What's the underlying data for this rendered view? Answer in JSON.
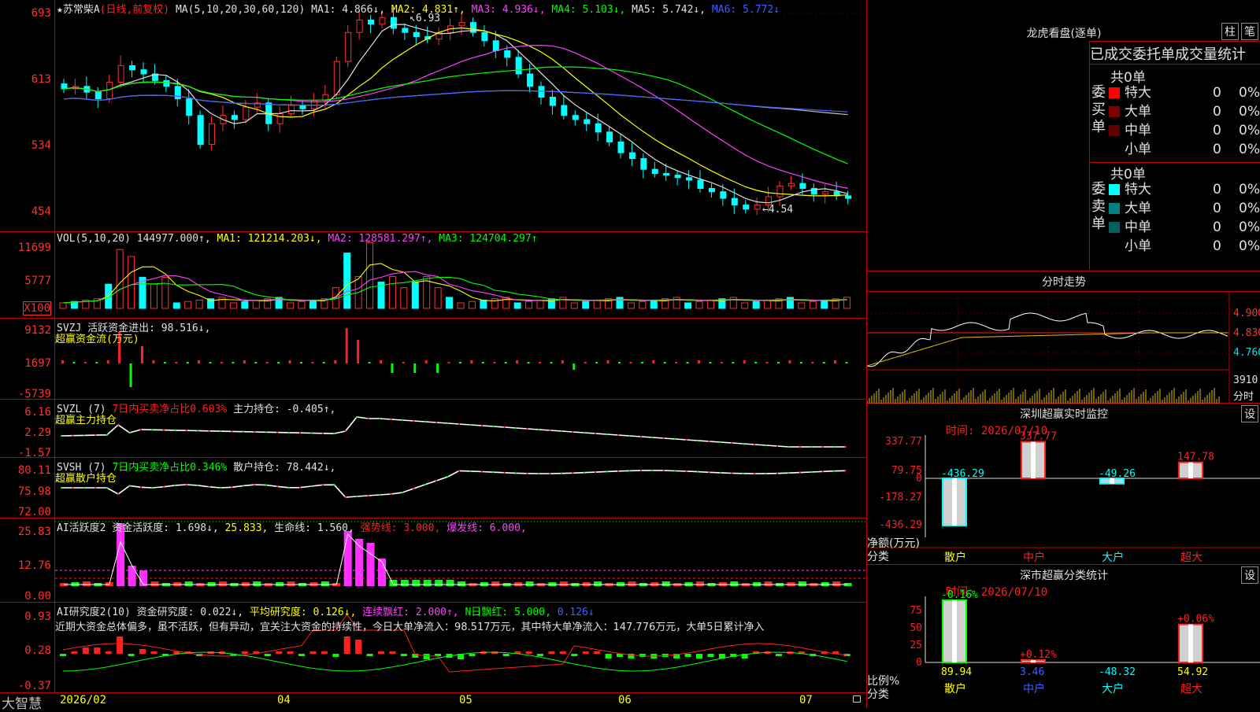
{
  "stock": {
    "name": "★苏常柴A",
    "mode": "(日线,前复权)"
  },
  "kline": {
    "ticks": [
      "693",
      "613",
      "534",
      "454"
    ],
    "ma_header": [
      {
        "t": "MA(5,10,20,30,60,120)",
        "c": "#e0e0e0"
      },
      {
        "t": " MA1: 4.866↓,",
        "c": "#e0e0e0"
      },
      {
        "t": " MA2: 4.831↑,",
        "c": "#ffff00"
      },
      {
        "t": " MA3: 4.936↓,",
        "c": "#ff40ff"
      },
      {
        "t": " MA4: 5.103↓,",
        "c": "#00ff00"
      },
      {
        "t": " MA5: 5.742↓,",
        "c": "#e0e0e0"
      },
      {
        "t": " MA6: 5.772↓",
        "c": "#4060ff"
      }
    ],
    "high_label": "6.93",
    "low_label": "4.54",
    "closes": [
      6.02,
      6.05,
      5.98,
      5.9,
      6.1,
      6.3,
      6.25,
      6.2,
      6.12,
      6.05,
      5.9,
      5.7,
      5.35,
      5.6,
      5.7,
      5.65,
      5.8,
      5.85,
      5.6,
      5.72,
      5.82,
      5.78,
      5.88,
      5.95,
      6.35,
      6.7,
      6.85,
      6.8,
      6.88,
      6.75,
      6.7,
      6.65,
      6.62,
      6.7,
      6.78,
      6.82,
      6.7,
      6.6,
      6.48,
      6.4,
      6.2,
      6.05,
      5.92,
      5.82,
      5.7,
      5.65,
      5.6,
      5.5,
      5.38,
      5.25,
      5.18,
      5.05,
      5.0,
      4.98,
      4.95,
      4.92,
      4.82,
      4.78,
      4.7,
      4.62,
      4.57,
      4.62,
      4.72,
      4.85,
      4.88,
      4.82,
      4.75,
      4.78,
      4.73,
      4.7
    ]
  },
  "vol": {
    "ticks": [
      "11699",
      "5777",
      "X100"
    ],
    "header": [
      {
        "t": "VOL(5,10,20)",
        "c": "#e0e0e0"
      },
      {
        "t": " 144977.000↑,",
        "c": "#e0e0e0"
      },
      {
        "t": " MA1: 121214.203↓,",
        "c": "#ffff00"
      },
      {
        "t": " MA2: 128581.297↑,",
        "c": "#ff40ff"
      },
      {
        "t": " MA3: 124704.297↑",
        "c": "#00ff00"
      }
    ]
  },
  "svzj": {
    "ticks": [
      "9132",
      "1697",
      "-5739"
    ],
    "header": [
      {
        "t": "SVZJ",
        "c": "#e0e0e0"
      },
      {
        "t": "  活跃资金进出: 98.516↓,",
        "c": "#e0e0e0"
      }
    ],
    "sub": "超赢资金流(万元)"
  },
  "svzl": {
    "ticks": [
      "6.16",
      "2.29",
      "-1.57"
    ],
    "header": [
      {
        "t": "SVZL (7)",
        "c": "#e0e0e0"
      },
      {
        "t": " 7日内买卖净占比0.603%",
        "c": "#ff2020"
      },
      {
        "t": " 主力持仓: -0.405↑,",
        "c": "#e0e0e0"
      }
    ],
    "sub": "超赢主力持仓"
  },
  "svsh": {
    "ticks": [
      "80.11",
      "75.98",
      "72.00"
    ],
    "header": [
      {
        "t": "SVSH (7)",
        "c": "#e0e0e0"
      },
      {
        "t": " 7日内买卖净占比0.346%",
        "c": "#00ff00"
      },
      {
        "t": " 散户持仓: 78.442↓,",
        "c": "#e0e0e0"
      }
    ],
    "sub": "超赢散户持仓"
  },
  "ai1": {
    "ticks": [
      "25.83",
      "12.76",
      "0.00"
    ],
    "header": [
      {
        "t": "AI活跃度2",
        "c": "#e0e0e0"
      },
      {
        "t": " 资金活跃度: 1.698↓,",
        "c": "#e0e0e0"
      },
      {
        "t": " 25.833,",
        "c": "#ffff00"
      },
      {
        "t": " 生命线: 1.560,",
        "c": "#e0e0e0"
      },
      {
        "t": " 强势线: 3.000,",
        "c": "#ff2020"
      },
      {
        "t": " 爆发线: 6.000,",
        "c": "#ff40ff"
      }
    ]
  },
  "ai2": {
    "ticks": [
      "0.93",
      "0.28",
      "-0.37"
    ],
    "header": [
      {
        "t": "AI研究度2(10)",
        "c": "#e0e0e0"
      },
      {
        "t": " 资金研究度: 0.022↓,",
        "c": "#e0e0e0"
      },
      {
        "t": " 平均研究度: 0.126↓,",
        "c": "#ffff00"
      },
      {
        "t": " 连续飘红: 2.000↑,",
        "c": "#ff40ff"
      },
      {
        "t": " N日飘红: 5.000,",
        "c": "#00ff00"
      },
      {
        "t": " 0.126↓",
        "c": "#4060ff"
      }
    ],
    "comment": "近期大资金总体偏多，虽不活跃，但有异动，宜关注大资金的持续性，今日大单净流入：98.517万元，其中特大单净流入：147.776万元，大单5日累计净入"
  },
  "dates": [
    "2026/02",
    "04",
    "05",
    "06",
    "07"
  ],
  "brand": "大智慧",
  "longhu": {
    "title": "龙虎看盘(逐单)",
    "btn_zhu": "柱",
    "btn_bi": "笔",
    "section_title": "已成交委托单成交量统计",
    "buy": {
      "label": "委买单",
      "total": "共0单",
      "rows": [
        {
          "name": "特大",
          "color": "#ff0000",
          "n": "0",
          "p": "0%"
        },
        {
          "name": "大单",
          "color": "#800000",
          "n": "0",
          "p": "0%"
        },
        {
          "name": "中单",
          "color": "#600000",
          "n": "0",
          "p": "0%"
        },
        {
          "name": "小单",
          "color": "#000000",
          "n": "0",
          "p": "0%"
        }
      ]
    },
    "sell": {
      "label": "委卖单",
      "total": "共0单",
      "rows": [
        {
          "name": "特大",
          "color": "#00ffff",
          "n": "0",
          "p": "0%"
        },
        {
          "name": "大单",
          "color": "#008080",
          "n": "0",
          "p": "0%"
        },
        {
          "name": "中单",
          "color": "#006060",
          "n": "0",
          "p": "0%"
        },
        {
          "name": "小单",
          "color": "#000000",
          "n": "0",
          "p": "0%"
        }
      ]
    }
  },
  "fenshi": {
    "title": "分时走势",
    "ticks": [
      "4.900",
      "4.830",
      "4.760"
    ],
    "vol_tick": "3910",
    "vol_unit": "分时"
  },
  "monitor": {
    "title": "深圳超赢实时监控",
    "btn": "设",
    "time": "时间: 2026/07/10",
    "ticks": [
      "337.77",
      "79.75",
      "0",
      "-178.27",
      "-436.29"
    ],
    "ylabel": "净额(万元)",
    "xlabel": "分类",
    "cats": [
      "散户",
      "中户",
      "大户",
      "超大"
    ],
    "values": [
      -436.29,
      337.77,
      -49.26,
      147.78
    ],
    "value_labels": [
      "-436.29",
      "337.77",
      "-49.26",
      "147.78"
    ]
  },
  "classify": {
    "title": "深市超赢分类统计",
    "btn": "设",
    "time": "时间: 2026/07/10",
    "ticks": [
      "75",
      "50",
      "25",
      "0"
    ],
    "ylabel": "比例%",
    "xlabel": "分类",
    "cats": [
      "散户",
      "中户",
      "大户",
      "超大"
    ],
    "values": [
      89.94,
      3.46,
      -48.32,
      54.92
    ],
    "change_labels": [
      "-0.16%",
      "+0.12%",
      "",
      "+0.06%"
    ],
    "value_labels": [
      "89.94",
      "3.46",
      "-48.32",
      "54.92"
    ]
  }
}
